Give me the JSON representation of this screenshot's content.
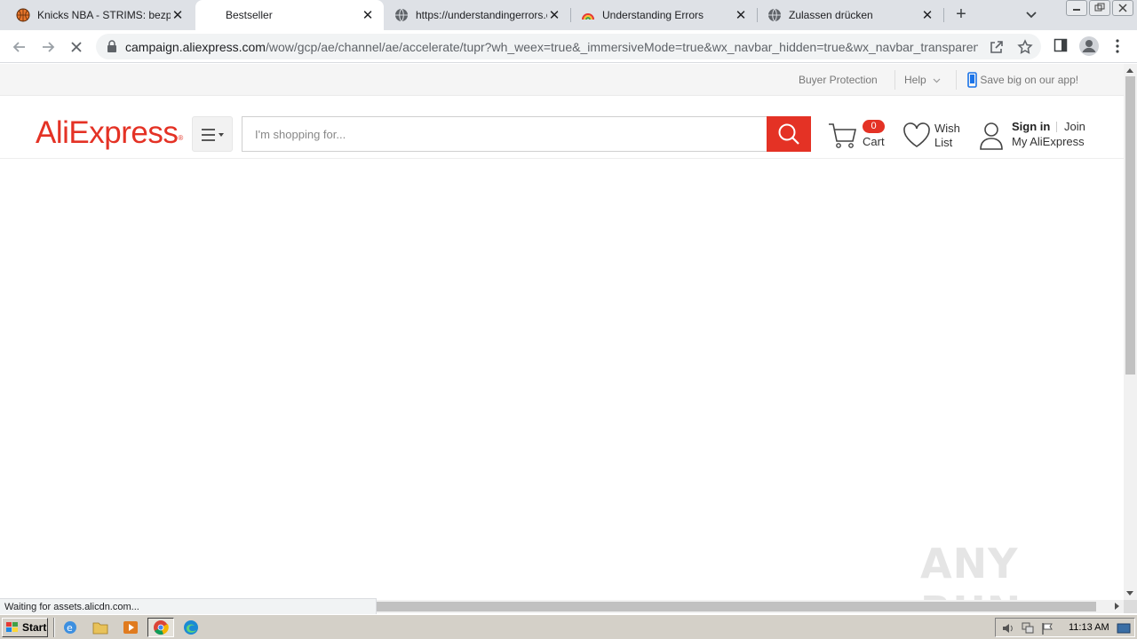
{
  "browser": {
    "tabs": [
      {
        "title": "Knicks NBA - STRIMS: bezpłatne",
        "active": false,
        "icon": "basketball-icon"
      },
      {
        "title": "Bestseller",
        "active": true,
        "icon": ""
      },
      {
        "title": "https://understandingerrors.com",
        "active": false,
        "icon": "globe-icon"
      },
      {
        "title": "Understanding Errors",
        "active": false,
        "icon": "rainbow-icon"
      },
      {
        "title": "Zulassen drücken",
        "active": false,
        "icon": "globe-icon"
      }
    ],
    "close_glyph": "✕",
    "new_tab_glyph": "+",
    "url_host": "campaign.aliexpress.com",
    "url_rest": "/wow/gcp/ae/channel/ae/accelerate/tupr?wh_weex=true&_immersiveMode=true&wx_navbar_hidden=true&wx_navbar_transparent=true",
    "status_text": "Waiting for assets.alicdn.com..."
  },
  "site": {
    "topbar": {
      "buyer_protection": "Buyer Protection",
      "help": "Help",
      "app_promo": "Save big on our app!"
    },
    "logo": "AliExpress",
    "logo_mark": "®",
    "search": {
      "placeholder": "I'm shopping for..."
    },
    "cart": {
      "count": "0",
      "label": "Cart"
    },
    "wishlist": {
      "line1": "Wish",
      "line2": "List"
    },
    "account": {
      "sign_in": "Sign in",
      "join": "Join",
      "my": "My AliExpress"
    }
  },
  "watermark": "ANY RUN",
  "taskbar": {
    "start": "Start",
    "clock": "11:13 AM"
  },
  "colors": {
    "brand": "#e43225",
    "tabstrip": "#dee1e6",
    "taskbar": "#d4d0c8"
  }
}
